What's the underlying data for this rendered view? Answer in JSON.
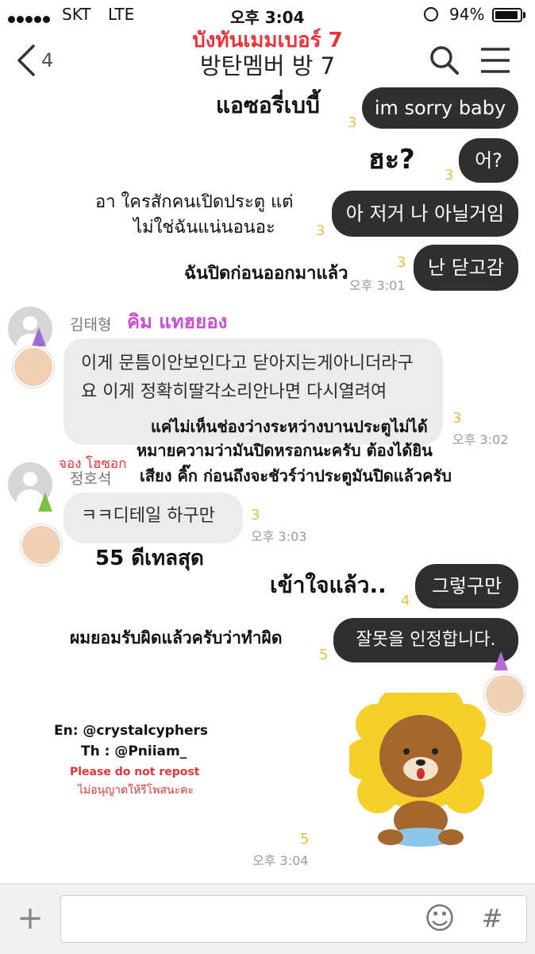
{
  "status_bar": {
    "carrier": "SKT",
    "network": "LTE",
    "time": "오후 3:04",
    "battery": "94%",
    "battery_level": 0.94
  },
  "header": {
    "back_count": "4",
    "title": "방탄멤버 방 7",
    "thai_title": "บังทันเมมเบอร์ 7"
  },
  "messages": [
    {
      "text": "im sorry baby",
      "unread": "3",
      "thai": "แอซอรี่เบบี้"
    },
    {
      "text": "어?",
      "unread": "3",
      "thai": "ฮะ?"
    },
    {
      "text": "아 저거 나 아닐거임",
      "unread": "3",
      "thai_line1": "อา ใครสักคนเปิดประตู แต่",
      "thai_line2": "ไม่ใช่ฉันแน่นอนอะ"
    },
    {
      "text": "난 닫고감",
      "unread": "3",
      "time": "오후 3:01",
      "thai": "ฉันปิดก่อนออกมาแล้ว"
    },
    {
      "sender": "김태형",
      "sender_thai": "คิม แทฮยอง",
      "text": "이게 문틈이안보인다고 닫아지는게아니더라구요 이게 정확히딸각소리안나면 다시열려여",
      "unread": "3",
      "time": "오후 3:02",
      "thai_line1": "แค่ไม่เห็นช่องว่างระหว่างบานประตูไม่ได้",
      "thai_line2": "หมายความว่ามันปิดหรอกนะครับ ต้องได้ยิน",
      "thai_line3": "เสียง คิ๊ก ก่อนถึงจะชัวร์ว่าประตูมันปิดแล้วครับ"
    },
    {
      "sender": "정호석",
      "sender_thai": "จอง โฮซอก",
      "text": "ㅋㅋ디테일 하구만",
      "unread": "3",
      "time": "오후 3:03",
      "thai": "55 ดีเทลสุด"
    },
    {
      "text": "그렇구만",
      "unread": "4",
      "thai": "เข้าใจแล้ว.."
    },
    {
      "text": "잘못을 인정합니다.",
      "unread": "5",
      "thai": "ผมยอมรับผิดแล้วครับว่าทำผิด"
    },
    {
      "type": "sticker",
      "unread": "5",
      "time": "오후 3:04"
    }
  ],
  "credits": {
    "en": "En: @crystalcyphers",
    "th": "Th : @Pniiam_",
    "warning_en": "Please do not repost",
    "warning_th": "ไม่อนุญาตให้รีโพสนะคะ"
  },
  "input_bar": {
    "plus": "+",
    "emoji": "☺",
    "hash": "#"
  },
  "colors": {
    "dark_bubble": "#2f2f2f",
    "light_bubble": "#ececec",
    "unread": "#e2c14a",
    "thai_title": "#e8343a",
    "thai_sender": "#c94fd0",
    "warning": "#e8343a"
  }
}
